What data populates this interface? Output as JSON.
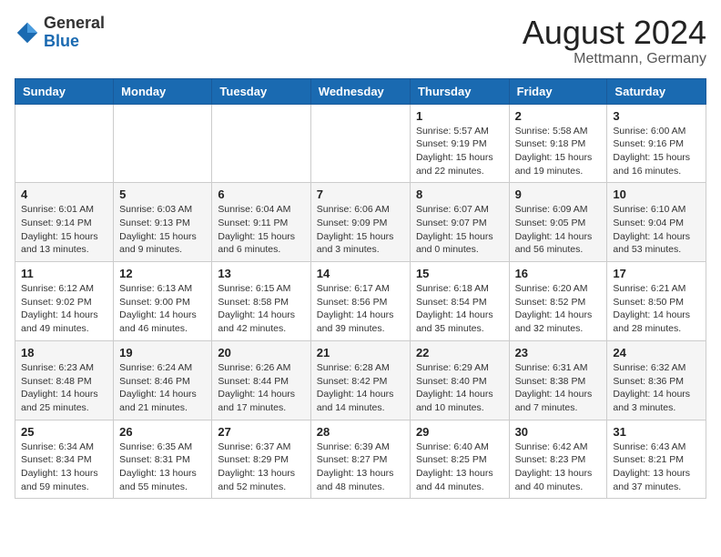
{
  "logo": {
    "general": "General",
    "blue": "Blue"
  },
  "header": {
    "title": "August 2024",
    "subtitle": "Mettmann, Germany"
  },
  "days_of_week": [
    "Sunday",
    "Monday",
    "Tuesday",
    "Wednesday",
    "Thursday",
    "Friday",
    "Saturday"
  ],
  "weeks": [
    [
      {
        "day": "",
        "info": ""
      },
      {
        "day": "",
        "info": ""
      },
      {
        "day": "",
        "info": ""
      },
      {
        "day": "",
        "info": ""
      },
      {
        "day": "1",
        "info": "Sunrise: 5:57 AM\nSunset: 9:19 PM\nDaylight: 15 hours\nand 22 minutes."
      },
      {
        "day": "2",
        "info": "Sunrise: 5:58 AM\nSunset: 9:18 PM\nDaylight: 15 hours\nand 19 minutes."
      },
      {
        "day": "3",
        "info": "Sunrise: 6:00 AM\nSunset: 9:16 PM\nDaylight: 15 hours\nand 16 minutes."
      }
    ],
    [
      {
        "day": "4",
        "info": "Sunrise: 6:01 AM\nSunset: 9:14 PM\nDaylight: 15 hours\nand 13 minutes."
      },
      {
        "day": "5",
        "info": "Sunrise: 6:03 AM\nSunset: 9:13 PM\nDaylight: 15 hours\nand 9 minutes."
      },
      {
        "day": "6",
        "info": "Sunrise: 6:04 AM\nSunset: 9:11 PM\nDaylight: 15 hours\nand 6 minutes."
      },
      {
        "day": "7",
        "info": "Sunrise: 6:06 AM\nSunset: 9:09 PM\nDaylight: 15 hours\nand 3 minutes."
      },
      {
        "day": "8",
        "info": "Sunrise: 6:07 AM\nSunset: 9:07 PM\nDaylight: 15 hours\nand 0 minutes."
      },
      {
        "day": "9",
        "info": "Sunrise: 6:09 AM\nSunset: 9:05 PM\nDaylight: 14 hours\nand 56 minutes."
      },
      {
        "day": "10",
        "info": "Sunrise: 6:10 AM\nSunset: 9:04 PM\nDaylight: 14 hours\nand 53 minutes."
      }
    ],
    [
      {
        "day": "11",
        "info": "Sunrise: 6:12 AM\nSunset: 9:02 PM\nDaylight: 14 hours\nand 49 minutes."
      },
      {
        "day": "12",
        "info": "Sunrise: 6:13 AM\nSunset: 9:00 PM\nDaylight: 14 hours\nand 46 minutes."
      },
      {
        "day": "13",
        "info": "Sunrise: 6:15 AM\nSunset: 8:58 PM\nDaylight: 14 hours\nand 42 minutes."
      },
      {
        "day": "14",
        "info": "Sunrise: 6:17 AM\nSunset: 8:56 PM\nDaylight: 14 hours\nand 39 minutes."
      },
      {
        "day": "15",
        "info": "Sunrise: 6:18 AM\nSunset: 8:54 PM\nDaylight: 14 hours\nand 35 minutes."
      },
      {
        "day": "16",
        "info": "Sunrise: 6:20 AM\nSunset: 8:52 PM\nDaylight: 14 hours\nand 32 minutes."
      },
      {
        "day": "17",
        "info": "Sunrise: 6:21 AM\nSunset: 8:50 PM\nDaylight: 14 hours\nand 28 minutes."
      }
    ],
    [
      {
        "day": "18",
        "info": "Sunrise: 6:23 AM\nSunset: 8:48 PM\nDaylight: 14 hours\nand 25 minutes."
      },
      {
        "day": "19",
        "info": "Sunrise: 6:24 AM\nSunset: 8:46 PM\nDaylight: 14 hours\nand 21 minutes."
      },
      {
        "day": "20",
        "info": "Sunrise: 6:26 AM\nSunset: 8:44 PM\nDaylight: 14 hours\nand 17 minutes."
      },
      {
        "day": "21",
        "info": "Sunrise: 6:28 AM\nSunset: 8:42 PM\nDaylight: 14 hours\nand 14 minutes."
      },
      {
        "day": "22",
        "info": "Sunrise: 6:29 AM\nSunset: 8:40 PM\nDaylight: 14 hours\nand 10 minutes."
      },
      {
        "day": "23",
        "info": "Sunrise: 6:31 AM\nSunset: 8:38 PM\nDaylight: 14 hours\nand 7 minutes."
      },
      {
        "day": "24",
        "info": "Sunrise: 6:32 AM\nSunset: 8:36 PM\nDaylight: 14 hours\nand 3 minutes."
      }
    ],
    [
      {
        "day": "25",
        "info": "Sunrise: 6:34 AM\nSunset: 8:34 PM\nDaylight: 13 hours\nand 59 minutes."
      },
      {
        "day": "26",
        "info": "Sunrise: 6:35 AM\nSunset: 8:31 PM\nDaylight: 13 hours\nand 55 minutes."
      },
      {
        "day": "27",
        "info": "Sunrise: 6:37 AM\nSunset: 8:29 PM\nDaylight: 13 hours\nand 52 minutes."
      },
      {
        "day": "28",
        "info": "Sunrise: 6:39 AM\nSunset: 8:27 PM\nDaylight: 13 hours\nand 48 minutes."
      },
      {
        "day": "29",
        "info": "Sunrise: 6:40 AM\nSunset: 8:25 PM\nDaylight: 13 hours\nand 44 minutes."
      },
      {
        "day": "30",
        "info": "Sunrise: 6:42 AM\nSunset: 8:23 PM\nDaylight: 13 hours\nand 40 minutes."
      },
      {
        "day": "31",
        "info": "Sunrise: 6:43 AM\nSunset: 8:21 PM\nDaylight: 13 hours\nand 37 minutes."
      }
    ]
  ]
}
